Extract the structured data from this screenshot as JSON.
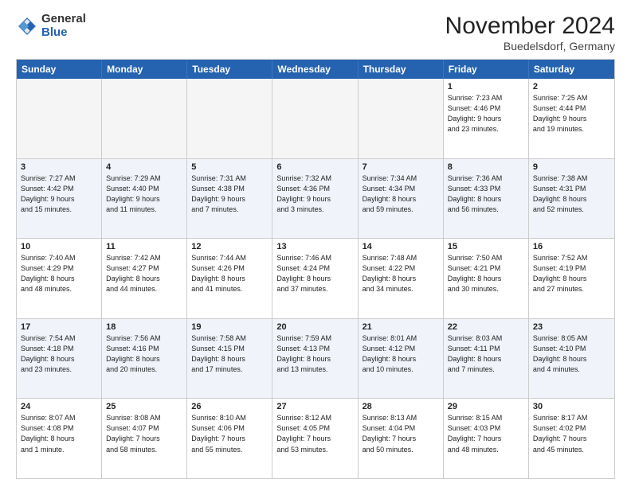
{
  "logo": {
    "general": "General",
    "blue": "Blue"
  },
  "header": {
    "month": "November 2024",
    "location": "Buedelsdorf, Germany"
  },
  "weekdays": [
    "Sunday",
    "Monday",
    "Tuesday",
    "Wednesday",
    "Thursday",
    "Friday",
    "Saturday"
  ],
  "rows": [
    [
      {
        "day": "",
        "info": "",
        "empty": true
      },
      {
        "day": "",
        "info": "",
        "empty": true
      },
      {
        "day": "",
        "info": "",
        "empty": true
      },
      {
        "day": "",
        "info": "",
        "empty": true
      },
      {
        "day": "",
        "info": "",
        "empty": true
      },
      {
        "day": "1",
        "info": "Sunrise: 7:23 AM\nSunset: 4:46 PM\nDaylight: 9 hours\nand 23 minutes.",
        "empty": false
      },
      {
        "day": "2",
        "info": "Sunrise: 7:25 AM\nSunset: 4:44 PM\nDaylight: 9 hours\nand 19 minutes.",
        "empty": false
      }
    ],
    [
      {
        "day": "3",
        "info": "Sunrise: 7:27 AM\nSunset: 4:42 PM\nDaylight: 9 hours\nand 15 minutes.",
        "empty": false
      },
      {
        "day": "4",
        "info": "Sunrise: 7:29 AM\nSunset: 4:40 PM\nDaylight: 9 hours\nand 11 minutes.",
        "empty": false
      },
      {
        "day": "5",
        "info": "Sunrise: 7:31 AM\nSunset: 4:38 PM\nDaylight: 9 hours\nand 7 minutes.",
        "empty": false
      },
      {
        "day": "6",
        "info": "Sunrise: 7:32 AM\nSunset: 4:36 PM\nDaylight: 9 hours\nand 3 minutes.",
        "empty": false
      },
      {
        "day": "7",
        "info": "Sunrise: 7:34 AM\nSunset: 4:34 PM\nDaylight: 8 hours\nand 59 minutes.",
        "empty": false
      },
      {
        "day": "8",
        "info": "Sunrise: 7:36 AM\nSunset: 4:33 PM\nDaylight: 8 hours\nand 56 minutes.",
        "empty": false
      },
      {
        "day": "9",
        "info": "Sunrise: 7:38 AM\nSunset: 4:31 PM\nDaylight: 8 hours\nand 52 minutes.",
        "empty": false
      }
    ],
    [
      {
        "day": "10",
        "info": "Sunrise: 7:40 AM\nSunset: 4:29 PM\nDaylight: 8 hours\nand 48 minutes.",
        "empty": false
      },
      {
        "day": "11",
        "info": "Sunrise: 7:42 AM\nSunset: 4:27 PM\nDaylight: 8 hours\nand 44 minutes.",
        "empty": false
      },
      {
        "day": "12",
        "info": "Sunrise: 7:44 AM\nSunset: 4:26 PM\nDaylight: 8 hours\nand 41 minutes.",
        "empty": false
      },
      {
        "day": "13",
        "info": "Sunrise: 7:46 AM\nSunset: 4:24 PM\nDaylight: 8 hours\nand 37 minutes.",
        "empty": false
      },
      {
        "day": "14",
        "info": "Sunrise: 7:48 AM\nSunset: 4:22 PM\nDaylight: 8 hours\nand 34 minutes.",
        "empty": false
      },
      {
        "day": "15",
        "info": "Sunrise: 7:50 AM\nSunset: 4:21 PM\nDaylight: 8 hours\nand 30 minutes.",
        "empty": false
      },
      {
        "day": "16",
        "info": "Sunrise: 7:52 AM\nSunset: 4:19 PM\nDaylight: 8 hours\nand 27 minutes.",
        "empty": false
      }
    ],
    [
      {
        "day": "17",
        "info": "Sunrise: 7:54 AM\nSunset: 4:18 PM\nDaylight: 8 hours\nand 23 minutes.",
        "empty": false
      },
      {
        "day": "18",
        "info": "Sunrise: 7:56 AM\nSunset: 4:16 PM\nDaylight: 8 hours\nand 20 minutes.",
        "empty": false
      },
      {
        "day": "19",
        "info": "Sunrise: 7:58 AM\nSunset: 4:15 PM\nDaylight: 8 hours\nand 17 minutes.",
        "empty": false
      },
      {
        "day": "20",
        "info": "Sunrise: 7:59 AM\nSunset: 4:13 PM\nDaylight: 8 hours\nand 13 minutes.",
        "empty": false
      },
      {
        "day": "21",
        "info": "Sunrise: 8:01 AM\nSunset: 4:12 PM\nDaylight: 8 hours\nand 10 minutes.",
        "empty": false
      },
      {
        "day": "22",
        "info": "Sunrise: 8:03 AM\nSunset: 4:11 PM\nDaylight: 8 hours\nand 7 minutes.",
        "empty": false
      },
      {
        "day": "23",
        "info": "Sunrise: 8:05 AM\nSunset: 4:10 PM\nDaylight: 8 hours\nand 4 minutes.",
        "empty": false
      }
    ],
    [
      {
        "day": "24",
        "info": "Sunrise: 8:07 AM\nSunset: 4:08 PM\nDaylight: 8 hours\nand 1 minute.",
        "empty": false
      },
      {
        "day": "25",
        "info": "Sunrise: 8:08 AM\nSunset: 4:07 PM\nDaylight: 7 hours\nand 58 minutes.",
        "empty": false
      },
      {
        "day": "26",
        "info": "Sunrise: 8:10 AM\nSunset: 4:06 PM\nDaylight: 7 hours\nand 55 minutes.",
        "empty": false
      },
      {
        "day": "27",
        "info": "Sunrise: 8:12 AM\nSunset: 4:05 PM\nDaylight: 7 hours\nand 53 minutes.",
        "empty": false
      },
      {
        "day": "28",
        "info": "Sunrise: 8:13 AM\nSunset: 4:04 PM\nDaylight: 7 hours\nand 50 minutes.",
        "empty": false
      },
      {
        "day": "29",
        "info": "Sunrise: 8:15 AM\nSunset: 4:03 PM\nDaylight: 7 hours\nand 48 minutes.",
        "empty": false
      },
      {
        "day": "30",
        "info": "Sunrise: 8:17 AM\nSunset: 4:02 PM\nDaylight: 7 hours\nand 45 minutes.",
        "empty": false
      }
    ]
  ]
}
